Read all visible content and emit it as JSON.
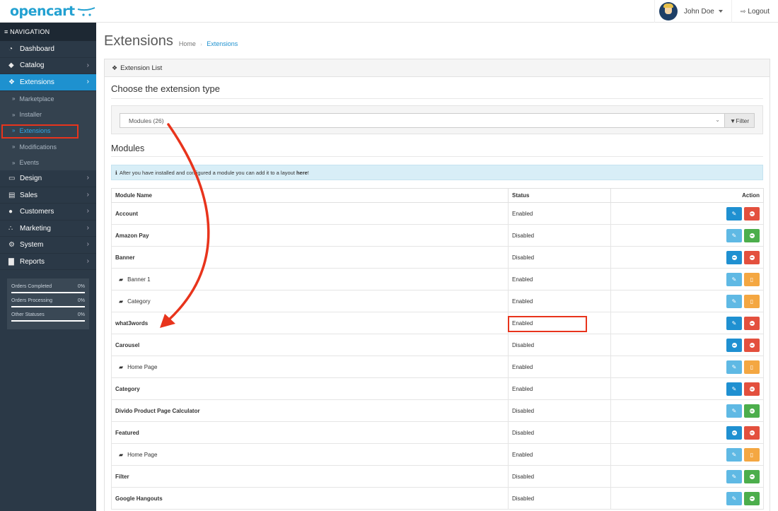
{
  "header": {
    "logo_text": "opencart",
    "user_name": "John Doe",
    "logout_label": "Logout"
  },
  "sidebar": {
    "nav_title": "NAVIGATION",
    "items": [
      {
        "label": "Dashboard",
        "icon": "dashboard-icon",
        "glyph": "◔"
      },
      {
        "label": "Catalog",
        "icon": "tag-icon",
        "glyph": "◆"
      },
      {
        "label": "Extensions",
        "icon": "puzzle-icon",
        "glyph": "❖"
      },
      {
        "label": "Design",
        "icon": "desktop-icon",
        "glyph": "▭"
      },
      {
        "label": "Sales",
        "icon": "cart-icon",
        "glyph": "▤"
      },
      {
        "label": "Customers",
        "icon": "user-icon",
        "glyph": "●"
      },
      {
        "label": "Marketing",
        "icon": "share-icon",
        "glyph": "∴"
      },
      {
        "label": "System",
        "icon": "gear-icon",
        "glyph": "⚙"
      },
      {
        "label": "Reports",
        "icon": "bar-chart-icon",
        "glyph": "▇"
      }
    ],
    "sub_items": [
      "Marketplace",
      "Installer",
      "Extensions",
      "Modifications",
      "Events"
    ],
    "stats": [
      {
        "label": "Orders Completed",
        "value": "0%"
      },
      {
        "label": "Orders Processing",
        "value": "0%"
      },
      {
        "label": "Other Statuses",
        "value": "0%"
      }
    ]
  },
  "page": {
    "title": "Extensions",
    "breadcrumb": [
      "Home",
      "Extensions"
    ]
  },
  "panel": {
    "heading": "Extension List",
    "choose_title": "Choose the extension type",
    "select_value": "Modules (26)",
    "filter_label": "Filter",
    "modules_title": "Modules",
    "alert_text": "After you have installed and configured a module you can add it to a layout",
    "alert_link": "here",
    "alert_end": "!"
  },
  "table": {
    "headers": [
      "Module Name",
      "Status",
      "Action"
    ],
    "rows": [
      {
        "name": "Account",
        "status": "Enabled",
        "child": false,
        "buttons": [
          "blue-edit",
          "red-uninstall"
        ]
      },
      {
        "name": "Amazon Pay",
        "status": "Disabled",
        "child": false,
        "buttons": [
          "lightblue-edit",
          "green-install"
        ]
      },
      {
        "name": "Banner",
        "status": "Disabled",
        "child": false,
        "buttons": [
          "blue-add",
          "red-uninstall"
        ]
      },
      {
        "name": "Banner 1",
        "status": "Enabled",
        "child": true,
        "buttons": [
          "lightblue-edit",
          "orange-delete"
        ]
      },
      {
        "name": "Category",
        "status": "Enabled",
        "child": true,
        "buttons": [
          "lightblue-edit",
          "orange-delete"
        ]
      },
      {
        "name": "what3words",
        "status": "Enabled",
        "child": false,
        "buttons": [
          "blue-edit",
          "red-uninstall"
        ]
      },
      {
        "name": "Carousel",
        "status": "Disabled",
        "child": false,
        "buttons": [
          "blue-add",
          "red-uninstall"
        ]
      },
      {
        "name": "Home Page",
        "status": "Enabled",
        "child": true,
        "buttons": [
          "lightblue-edit",
          "orange-delete"
        ]
      },
      {
        "name": "Category",
        "status": "Enabled",
        "child": false,
        "buttons": [
          "blue-edit",
          "red-uninstall"
        ]
      },
      {
        "name": "Divido Product Page Calculator",
        "status": "Disabled",
        "child": false,
        "buttons": [
          "lightblue-edit",
          "green-install"
        ]
      },
      {
        "name": "Featured",
        "status": "Disabled",
        "child": false,
        "buttons": [
          "blue-add",
          "red-uninstall"
        ]
      },
      {
        "name": "Home Page",
        "status": "Enabled",
        "child": true,
        "buttons": [
          "lightblue-edit",
          "orange-delete"
        ]
      },
      {
        "name": "Filter",
        "status": "Disabled",
        "child": false,
        "buttons": [
          "lightblue-edit",
          "green-install"
        ]
      },
      {
        "name": "Google Hangouts",
        "status": "Disabled",
        "child": false,
        "buttons": [
          "lightblue-edit",
          "green-install"
        ]
      }
    ]
  },
  "colors": {
    "sidebar_bg": "#2b3947",
    "active": "#1e91cf",
    "annotation": "#e8341c"
  }
}
